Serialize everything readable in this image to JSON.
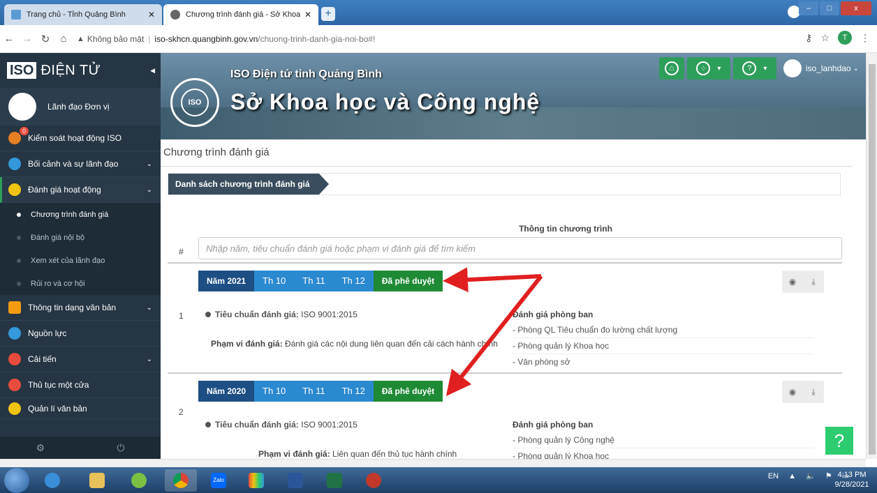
{
  "browser": {
    "tabs": [
      {
        "title": "Trang chủ - Tỉnh Quảng Bình",
        "active": false
      },
      {
        "title": "Chương trình đánh giá - Sở Khoa",
        "active": true
      }
    ],
    "new_tab": "+",
    "window_controls": {
      "minimize": "–",
      "maximize": "□",
      "close": "x"
    },
    "url_warning": "Không bảo mật",
    "url_domain": "iso-skhcn.quangbinh.gov.vn",
    "url_path": "/chuong-trinh-danh-gia-noi-bo#!",
    "account_initial": "T"
  },
  "sidebar": {
    "brand_iso": "ISO",
    "brand_text": "ĐIỆN TỬ",
    "user_name": "Lãnh đạo Đơn vị",
    "items": [
      {
        "label": "Kiểm soát hoạt động ISO",
        "badge": "0",
        "color": "#e67e22"
      },
      {
        "label": "Bối cảnh và sự lãnh đạo",
        "color": "#3498db",
        "chevron": true
      },
      {
        "label": "Đánh giá hoạt động",
        "color": "#f1c40f",
        "chevron": true,
        "active": true
      },
      {
        "label": "Thông tin dạng văn bản",
        "color": "#f39c12",
        "chevron": true
      },
      {
        "label": "Nguồn lực",
        "color": "#3498db"
      },
      {
        "label": "Cải tiến",
        "color": "#e74c3c",
        "chevron": true
      },
      {
        "label": "Thủ tục một cửa",
        "color": "#e74c3c"
      },
      {
        "label": "Quản lí văn bản",
        "color": "#f1c40f"
      }
    ],
    "subitems": [
      {
        "label": "Chương trình đánh giá",
        "current": true
      },
      {
        "label": "Đánh giá nội bộ"
      },
      {
        "label": "Xem xét của lãnh đạo"
      },
      {
        "label": "Rủi ro và cơ hội"
      }
    ]
  },
  "banner": {
    "seal_text": "ISO",
    "title_small": "ISO Điện tử tỉnh Quảng Bình",
    "title_large": "Sở Khoa học và Công nghệ",
    "username": "iso_lanhdao"
  },
  "content": {
    "title": "Chương trình đánh giá",
    "breadcrumb": "Danh sách chương trình đánh giá",
    "table_header_info": "Thông tin chương trình",
    "table_header_hash": "#",
    "search_placeholder": "Nhập năm, tiêu chuẩn đánh giá hoặc phạm vi đánh giá để tìm kiếm",
    "programs": [
      {
        "index": "1",
        "year": "Năm 2021",
        "months": [
          "Th 10",
          "Th 11",
          "Th 12"
        ],
        "status": "Đã phê duyệt",
        "standard_label": "Tiêu chuẩn đánh giá:",
        "standard": "ISO 9001:2015",
        "scope_label": "Phạm vi đánh giá:",
        "scope": "Đánh giá các nội dung liên quan đến cải cách hành chính",
        "dept_header": "Đánh giá phòng ban",
        "departments": [
          "- Phòng QL Tiêu chuẩn đo lường chất lượng",
          "- Phòng quản lý Khoa học",
          "- Văn phòng sở"
        ]
      },
      {
        "index": "2",
        "year": "Năm 2020",
        "months": [
          "Th 10",
          "Th 11",
          "Th 12"
        ],
        "status": "Đã phê duyệt",
        "standard_label": "Tiêu chuẩn đánh giá:",
        "standard": "ISO 9001:2015",
        "scope_label": "Phạm vi đánh giá:",
        "scope": "Liên quan đến thủ tục hành chính",
        "dept_header": "Đánh giá phòng ban",
        "departments": [
          "- Phòng quản lý Công nghệ",
          "- Phòng quản lý Khoa học"
        ]
      }
    ],
    "help": "?"
  },
  "taskbar": {
    "lang": "EN",
    "time": "4:13 PM",
    "date": "9/28/2021",
    "zalo": "Zalo"
  },
  "colors": {
    "sidebar": "#253543",
    "green": "#2e9e5b",
    "year_pill": "#1d4f84",
    "month_pill": "#2b89cf",
    "status_pill": "#1f8a35",
    "arrow": "#e02020"
  }
}
